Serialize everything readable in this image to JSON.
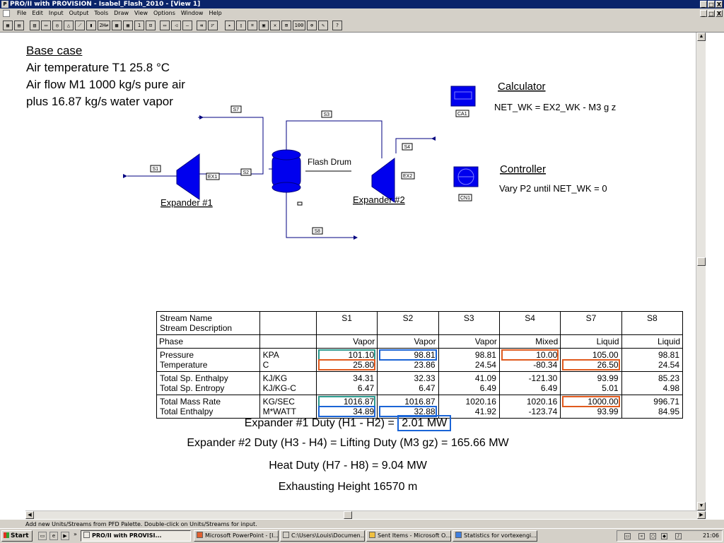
{
  "window": {
    "title": "PRO/II with PROVISION - Isabel_Flash_2010 - [View 1]",
    "menu": [
      "File",
      "Edit",
      "Input",
      "Output",
      "Tools",
      "Draw",
      "View",
      "Options",
      "Window",
      "Help"
    ],
    "controls": [
      "_",
      "□",
      "X"
    ]
  },
  "toolbar": {
    "buttons": [
      "calculator-tool",
      "save-tool",
      "sheet-tool",
      "display-tool",
      "pump-tool",
      "alarm-tool",
      "chart-tool",
      "chart-bars-tool",
      "units-tool",
      "mix-tool",
      "table-tool",
      "number-tool",
      "flag-tool",
      "rect-tool",
      "arrow-left-tool",
      "line-tool",
      "stream-tool",
      "run-tool",
      "play-tool",
      "step-tool",
      "ruler-tool",
      "grid-tool",
      "delete-tool",
      "move-tool",
      "zoom100-tool",
      "zoom-tool",
      "draw-tool",
      "help-tool"
    ],
    "labels": {
      "zoom100": "100",
      "units": "2H⇄"
    }
  },
  "case_notes": {
    "heading": "Base case",
    "line1": "Air temperature T1 25.8 °C",
    "line2": "Air flow M1 1000 kg/s pure air",
    "line3": "plus 16.87 kg/s water vapor"
  },
  "flowsheet": {
    "streams": [
      "S1",
      "S2",
      "S3",
      "S4",
      "S7",
      "S8"
    ],
    "units": {
      "ex1": {
        "tag": "EX1",
        "label": "Expander #1"
      },
      "ex2": {
        "tag": "EX2",
        "label": "Expander #2"
      },
      "flash": {
        "label": "Flash Drum"
      },
      "ca1": {
        "tag": "CA1",
        "label": "Calculator",
        "desc": "NET_WK = EX2_WK - M3 g z"
      },
      "cn1": {
        "tag": "CN1",
        "label": "Controller",
        "desc": "Vary P2 until NET_WK = 0"
      }
    },
    "colors": {
      "unit_fill": "#0000ee",
      "line": "#000080"
    }
  },
  "table": {
    "header": {
      "name": "Stream Name",
      "desc": "Stream Description",
      "streams": [
        "S1",
        "S2",
        "S3",
        "S4",
        "S7",
        "S8"
      ]
    },
    "phase": {
      "label": "Phase",
      "values": [
        "Vapor",
        "Vapor",
        "Vapor",
        "Mixed",
        "Liquid",
        "Liquid"
      ]
    },
    "rows": [
      {
        "label": "Pressure",
        "unit": "KPA",
        "values": [
          "101.10",
          "98.81",
          "98.81",
          "10.00",
          "105.00",
          "98.81"
        ]
      },
      {
        "label": "Temperature",
        "unit": "C",
        "values": [
          "25.80",
          "23.86",
          "24.54",
          "-80.34",
          "26.50",
          "24.54"
        ]
      },
      {
        "label": "Total Sp. Enthalpy",
        "unit": "KJ/KG",
        "values": [
          "34.31",
          "32.33",
          "41.09",
          "-121.30",
          "93.99",
          "85.23"
        ]
      },
      {
        "label": "Total Sp. Entropy",
        "unit": "KJ/KG-C",
        "values": [
          "6.47",
          "6.47",
          "6.49",
          "6.49",
          "5.01",
          "4.98"
        ]
      },
      {
        "label": "Total Mass Rate",
        "unit": "KG/SEC",
        "values": [
          "1016.87",
          "1016.87",
          "1020.16",
          "1020.16",
          "1000.00",
          "996.71"
        ]
      },
      {
        "label": "Total Enthalpy",
        "unit": "M*WATT",
        "values": [
          "34.89",
          "32.88",
          "41.92",
          "-123.74",
          "93.99",
          "84.95"
        ]
      }
    ],
    "highlight_colors": {
      "teal": "#2b9a8e",
      "blue": "#1a64d6",
      "orange": "#e05a1e"
    }
  },
  "summary": {
    "exp1_prefix": "Expander #1 Duty  (H1 - H2) = ",
    "exp1_value": "2.01 MW",
    "exp2": "Expander #2 Duty  (H3 - H4) = Lifting Duty (M3 gz) =  165.66 MW",
    "heat": "Heat Duty (H7 - H8) = 9.04 MW",
    "height": "Exhausting Height 16570 m"
  },
  "status": "Add new Units/Streams from PFD Palette.  Double-click on Units/Streams for input.",
  "taskbar": {
    "start": "Start",
    "chevron": "»",
    "tasks": [
      "PRO/II with PROVISI...",
      "Microsoft PowerPoint - [I...",
      "C:\\Users\\Louis\\Documen...",
      "Sent Items - Microsoft O...",
      "Statistics for vortexengi..."
    ],
    "clock": "21:06"
  }
}
